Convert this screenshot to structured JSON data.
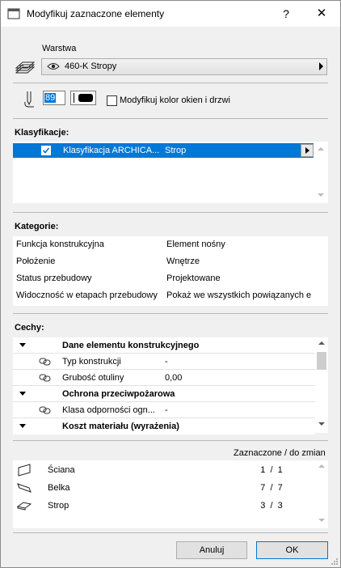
{
  "window": {
    "title": "Modyfikuj zaznaczone elementy",
    "help_label": "?",
    "close_label": "✕"
  },
  "layer": {
    "label": "Warstwa",
    "value": "460-K Stropy"
  },
  "pen": {
    "value": "89",
    "modify_color_label": "Modyfikuj kolor okien i drzwi",
    "modify_color_checked": false
  },
  "classification": {
    "label": "Klasyfikacje:",
    "rows": [
      {
        "checked": true,
        "name": "Klasyfikacja ARCHICA...",
        "value": "Strop"
      }
    ]
  },
  "categories": {
    "label": "Kategorie:",
    "rows": [
      {
        "name": "Funkcja konstrukcyjna",
        "value": "Element nośny"
      },
      {
        "name": "Położenie",
        "value": "Wnętrze"
      },
      {
        "name": "Status przebudowy",
        "value": "Projektowane"
      },
      {
        "name": "Widoczność w etapach przebudowy",
        "value": "Pokaż we wszystkich powiązanych e"
      }
    ]
  },
  "features": {
    "label": "Cechy:",
    "rows": [
      {
        "type": "group",
        "name": "Dane elementu konstrukcyjnego"
      },
      {
        "type": "item",
        "name": "Typ konstrukcji",
        "value": "-"
      },
      {
        "type": "item",
        "name": "Grubość otuliny",
        "value": "0,00"
      },
      {
        "type": "group",
        "name": "Ochrona przeciwpożarowa"
      },
      {
        "type": "item",
        "name": "Klasa odporności ogn...",
        "value": "-"
      },
      {
        "type": "group",
        "name": "Koszt materiału (wyrażenia)"
      }
    ]
  },
  "selection": {
    "header": "Zaznaczone / do zmian",
    "rows": [
      {
        "icon": "wall-icon",
        "name": "Ściana",
        "count": "1  /  1"
      },
      {
        "icon": "beam-icon",
        "name": "Belka",
        "count": "7  /  7"
      },
      {
        "icon": "slab-icon",
        "name": "Strop",
        "count": "3  /  3"
      }
    ]
  },
  "buttons": {
    "cancel_label": "Anuluj",
    "ok_label": "OK"
  }
}
